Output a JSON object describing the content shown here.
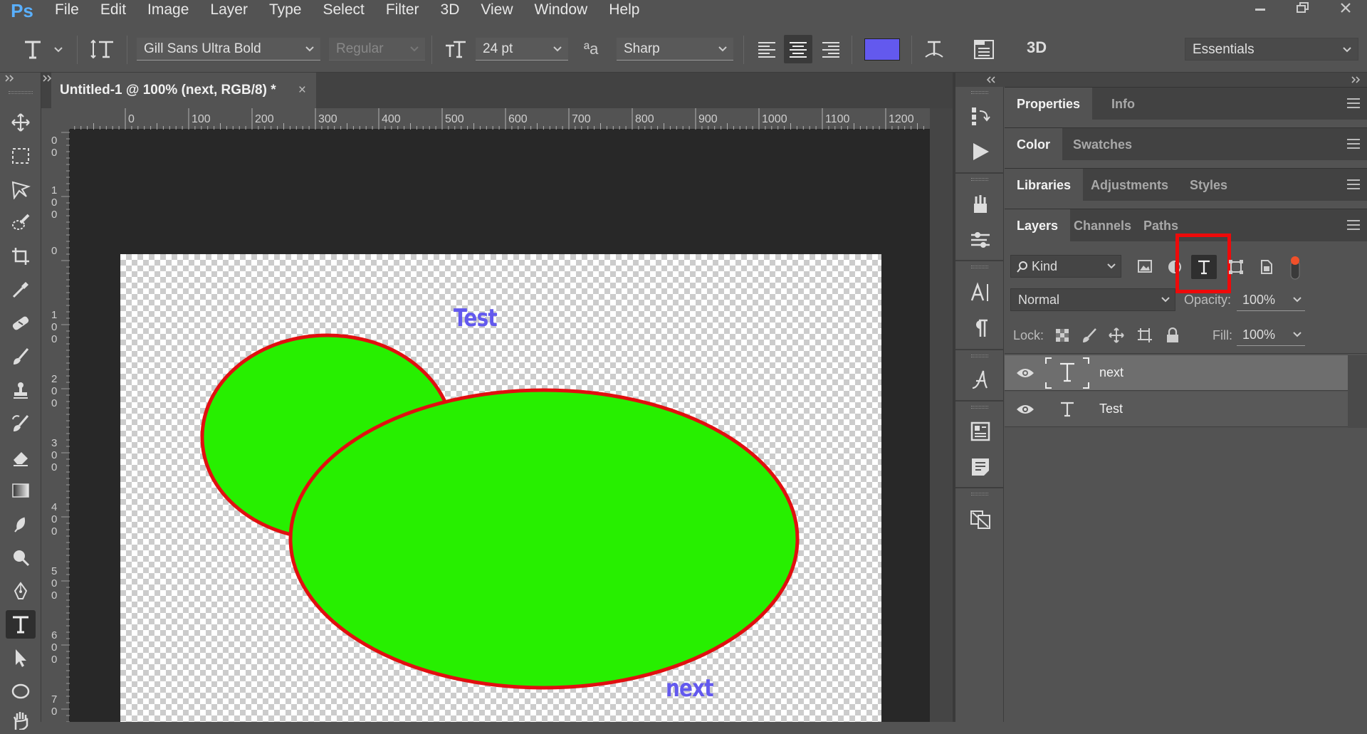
{
  "app": {
    "logo": "Ps"
  },
  "menu": [
    "File",
    "Edit",
    "Image",
    "Layer",
    "Type",
    "Select",
    "Filter",
    "3D",
    "View",
    "Window",
    "Help"
  ],
  "options": {
    "font_family": "Gill Sans Ultra Bold",
    "font_style": "Regular",
    "font_size": "24 pt",
    "aa_label": "ªa",
    "antialias": "Sharp",
    "text_color": "#6359ee",
    "threed": "3D",
    "workspace": "Essentials"
  },
  "document": {
    "tab_title": "Untitled-1 @ 100% (next, RGB/8) *",
    "close": "×",
    "ruler_h": [
      "0",
      "100",
      "200",
      "300",
      "400",
      "500",
      "600",
      "700",
      "800",
      "900",
      "1000",
      "1100",
      "1200"
    ],
    "ruler_v": [
      [
        "0",
        "0"
      ],
      [
        "1",
        "0",
        "0"
      ],
      [
        "0"
      ],
      [
        "1",
        "0",
        "0"
      ],
      [
        "2",
        "0",
        "0"
      ],
      [
        "3",
        "0",
        "0"
      ],
      [
        "4",
        "0",
        "0"
      ],
      [
        "5",
        "0",
        "0"
      ],
      [
        "6",
        "0",
        "0"
      ],
      [
        "7",
        "0"
      ]
    ],
    "canvas_texts": {
      "test": "Test",
      "next": "next"
    },
    "shape_fill": "#27ef00",
    "shape_stroke": "#e10f0f"
  },
  "panels": {
    "group1": {
      "tabs": [
        "Properties",
        "Info"
      ]
    },
    "group2": {
      "tabs": [
        "Color",
        "Swatches"
      ]
    },
    "group3": {
      "tabs": [
        "Libraries",
        "Adjustments",
        "Styles"
      ]
    },
    "layers": {
      "tabs": [
        "Layers",
        "Channels",
        "Paths"
      ],
      "filter_kind": "Kind",
      "blend_mode": "Normal",
      "opacity_label": "Opacity:",
      "opacity_value": "100%",
      "lock_label": "Lock:",
      "fill_label": "Fill:",
      "fill_value": "100%",
      "items": [
        {
          "name": "next",
          "selected": true
        },
        {
          "name": "Test",
          "selected": false
        }
      ]
    }
  }
}
